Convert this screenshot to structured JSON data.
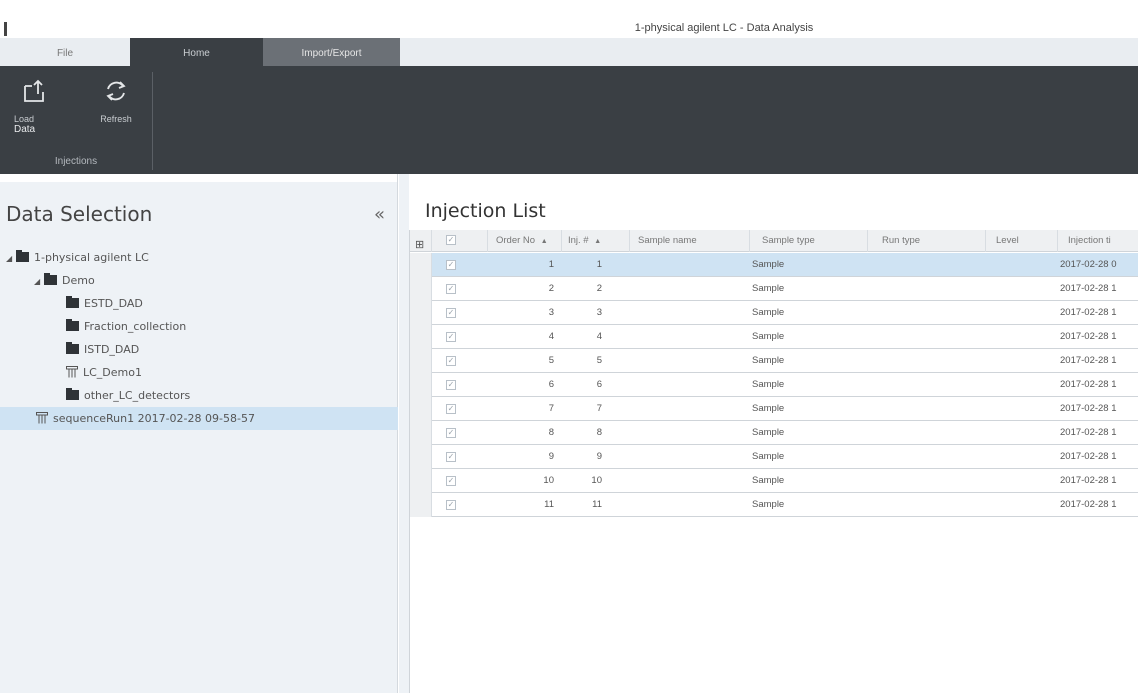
{
  "window": {
    "title": "1-physical agilent LC - Data Analysis"
  },
  "tabs": [
    {
      "label": "File"
    },
    {
      "label": "Home"
    },
    {
      "label": "Import/Export"
    }
  ],
  "ribbon": {
    "load_data_label": "Load Data",
    "load_line1": "Load",
    "load_line2": "Data",
    "refresh_label": "Refresh",
    "group_label": "Injections"
  },
  "data_selection": {
    "title": "Data Selection",
    "collapse_glyph": "«",
    "tree": [
      {
        "label": "1-physical agilent LC",
        "level": 0,
        "type": "folder",
        "expanded": true
      },
      {
        "label": "Demo",
        "level": 1,
        "type": "folder",
        "expanded": true
      },
      {
        "label": "ESTD_DAD",
        "level": 2,
        "type": "folder"
      },
      {
        "label": "Fraction_collection",
        "level": 2,
        "type": "folder"
      },
      {
        "label": "ISTD_DAD",
        "level": 2,
        "type": "folder"
      },
      {
        "label": "LC_Demo1",
        "level": 2,
        "type": "sequence"
      },
      {
        "label": "other_LC_detectors",
        "level": 2,
        "type": "folder"
      },
      {
        "label": "sequenceRun1 2017-02-28 09-58-57",
        "level": 1,
        "type": "sequence",
        "selected": true
      }
    ]
  },
  "injection_list": {
    "title": "Injection List",
    "columns": {
      "order_no": "Order No",
      "inj_no": "Inj. #",
      "sample_name": "Sample name",
      "sample_type": "Sample type",
      "run_type": "Run type",
      "level": "Level",
      "injection_time": "Injection ti"
    },
    "sort_glyph": "▲",
    "rows": [
      {
        "order": "1",
        "inj": "1",
        "name": "",
        "type": "Sample",
        "run": "",
        "level": "",
        "time": "2017-02-28 0"
      },
      {
        "order": "2",
        "inj": "2",
        "name": "",
        "type": "Sample",
        "run": "",
        "level": "",
        "time": "2017-02-28 1"
      },
      {
        "order": "3",
        "inj": "3",
        "name": "",
        "type": "Sample",
        "run": "",
        "level": "",
        "time": "2017-02-28 1"
      },
      {
        "order": "4",
        "inj": "4",
        "name": "",
        "type": "Sample",
        "run": "",
        "level": "",
        "time": "2017-02-28 1"
      },
      {
        "order": "5",
        "inj": "5",
        "name": "",
        "type": "Sample",
        "run": "",
        "level": "",
        "time": "2017-02-28 1"
      },
      {
        "order": "6",
        "inj": "6",
        "name": "",
        "type": "Sample",
        "run": "",
        "level": "",
        "time": "2017-02-28 1"
      },
      {
        "order": "7",
        "inj": "7",
        "name": "",
        "type": "Sample",
        "run": "",
        "level": "",
        "time": "2017-02-28 1"
      },
      {
        "order": "8",
        "inj": "8",
        "name": "",
        "type": "Sample",
        "run": "",
        "level": "",
        "time": "2017-02-28 1"
      },
      {
        "order": "9",
        "inj": "9",
        "name": "",
        "type": "Sample",
        "run": "",
        "level": "",
        "time": "2017-02-28 1"
      },
      {
        "order": "10",
        "inj": "10",
        "name": "",
        "type": "Sample",
        "run": "",
        "level": "",
        "time": "2017-02-28 1"
      },
      {
        "order": "11",
        "inj": "11",
        "name": "",
        "type": "Sample",
        "run": "",
        "level": "",
        "time": "2017-02-28 1"
      }
    ],
    "selected_row": 0,
    "check_glyph": "✓"
  },
  "colors": {
    "ribbon_bg": "#3a3f44",
    "selection": "#cfe3f3",
    "panel_bg": "#eef2f6"
  }
}
